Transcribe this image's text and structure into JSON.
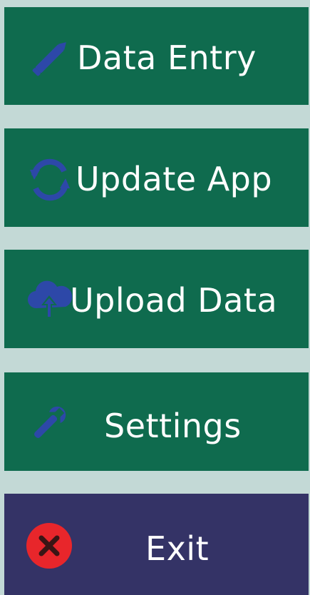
{
  "menu": {
    "items": [
      {
        "label": "Data Entry",
        "icon": "pencil-icon"
      },
      {
        "label": "Update App",
        "icon": "sync-icon"
      },
      {
        "label": "Upload Data",
        "icon": "cloud-upload-icon"
      },
      {
        "label": "Settings",
        "icon": "wrench-icon"
      },
      {
        "label": "Exit",
        "icon": "close-circle-icon"
      }
    ]
  },
  "colors": {
    "background": "#c3d9d6",
    "button_green": "#0f6b4e",
    "button_navy": "#343366",
    "icon_blue": "#2d48a8",
    "exit_red": "#e8262b",
    "text": "#ffffff"
  }
}
